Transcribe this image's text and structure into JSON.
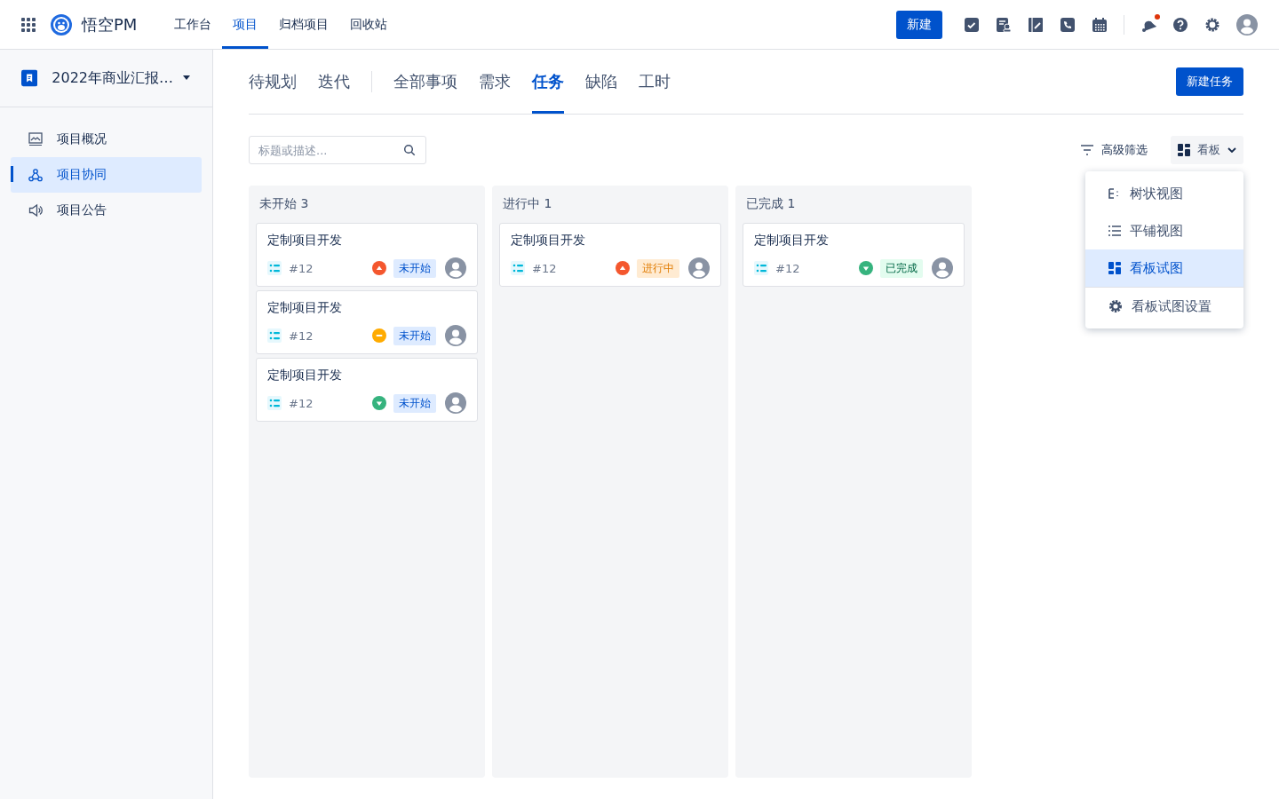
{
  "topbar": {
    "brand": "悟空PM",
    "nav": [
      {
        "label": "工作台",
        "selected": false
      },
      {
        "label": "项目",
        "selected": true
      },
      {
        "label": "归档项目",
        "selected": false
      },
      {
        "label": "回收站",
        "selected": false
      }
    ],
    "new_button": "新建",
    "notification_dot": true
  },
  "sidebar": {
    "project": "2022年商业汇报…",
    "items": [
      {
        "label": "项目概况",
        "kind": "overview",
        "selected": false
      },
      {
        "label": "项目协同",
        "kind": "collab",
        "selected": true
      },
      {
        "label": "项目公告",
        "kind": "notice",
        "selected": false
      }
    ]
  },
  "tab_groups": [
    [
      {
        "label": "待规划",
        "selected": false
      },
      {
        "label": "迭代",
        "selected": false
      }
    ],
    [
      {
        "label": "全部事项",
        "selected": false
      },
      {
        "label": "需求",
        "selected": false
      },
      {
        "label": "任务",
        "selected": true
      },
      {
        "label": "缺陷",
        "selected": false
      },
      {
        "label": "工时",
        "selected": false
      }
    ]
  ],
  "new_task_button": "新建任务",
  "search": {
    "placeholder": "标题或描述..."
  },
  "filter_button": "高级筛选",
  "view_button": "看板",
  "view_menu": [
    {
      "label": "树状视图",
      "kind": "tree",
      "selected": false
    },
    {
      "label": "平铺视图",
      "kind": "list",
      "selected": false
    },
    {
      "label": "看板试图",
      "kind": "board",
      "selected": true
    },
    {
      "label": "看板试图设置",
      "kind": "settings",
      "selected": false
    }
  ],
  "columns": [
    {
      "title": "未开始",
      "count": "3",
      "cards": [
        {
          "title": "定制项目开发",
          "number": "#12",
          "priority": {
            "kind": "high"
          },
          "status": {
            "label": "未开始",
            "kind": "todo"
          }
        },
        {
          "title": "定制项目开发",
          "number": "#12",
          "priority": {
            "kind": "medium"
          },
          "status": {
            "label": "未开始",
            "kind": "todo"
          }
        },
        {
          "title": "定制项目开发",
          "number": "#12",
          "priority": {
            "kind": "low"
          },
          "status": {
            "label": "未开始",
            "kind": "todo"
          }
        }
      ]
    },
    {
      "title": "进行中",
      "count": "1",
      "cards": [
        {
          "title": "定制项目开发",
          "number": "#12",
          "priority": {
            "kind": "high"
          },
          "status": {
            "label": "进行中",
            "kind": "doing"
          }
        }
      ]
    },
    {
      "title": "已完成",
      "count": "1",
      "cards": [
        {
          "title": "定制项目开发",
          "number": "#12",
          "priority": {
            "kind": "low"
          },
          "status": {
            "label": "已完成",
            "kind": "done"
          }
        }
      ]
    }
  ]
}
